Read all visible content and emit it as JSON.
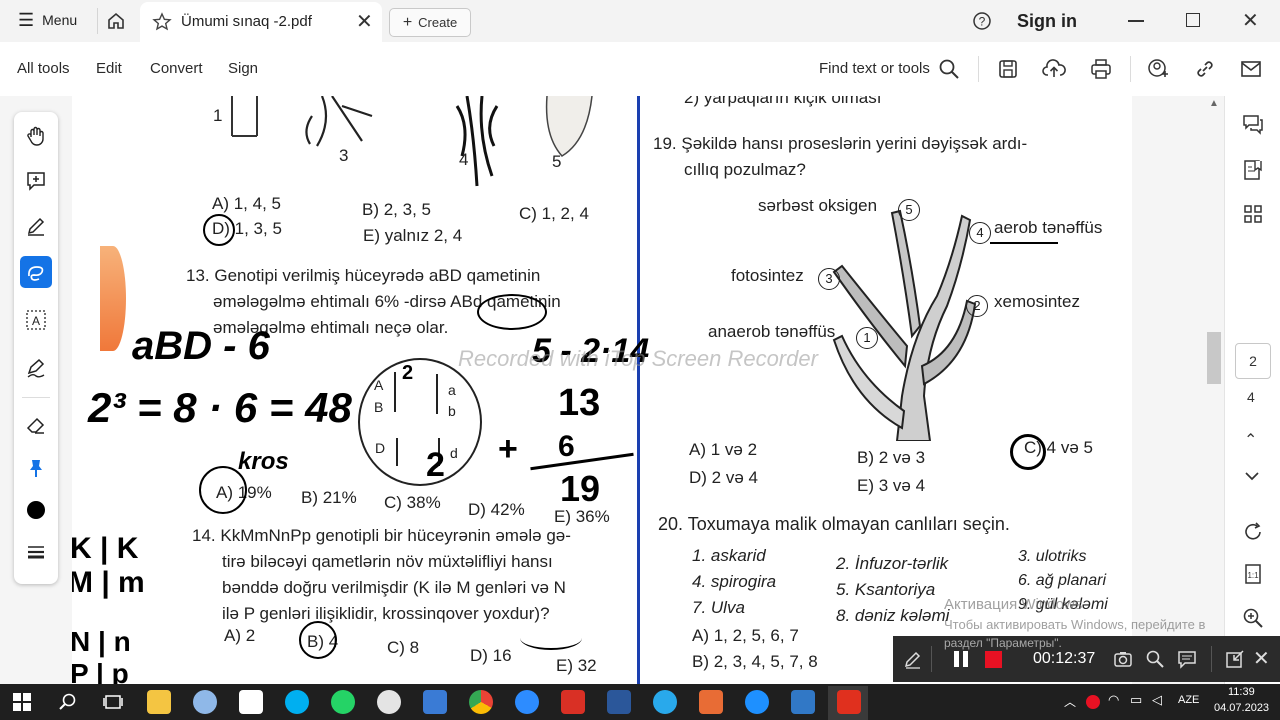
{
  "titlebar": {
    "menu_label": "Menu",
    "tab_title": "Ümumi sınaq -2.pdf",
    "create_label": "Create",
    "signin_label": "Sign in"
  },
  "toolbar": {
    "all_tools": "All tools",
    "edit": "Edit",
    "convert": "Convert",
    "sign": "Sign",
    "find_text": "Find text or tools"
  },
  "pager": {
    "current": "2",
    "total": "4"
  },
  "doc": {
    "top_label_1": "1",
    "fig_labels": [
      "3",
      "4",
      "5"
    ],
    "q12_answers": {
      "a": "A) 1, 4, 5",
      "b": "B) 2, 3, 5",
      "c": "C) 1, 2, 4",
      "d": "D) 1, 3, 5",
      "e": "E) yalnız 2, 4"
    },
    "q13_line1": "13. Genotipi verilmiş hüceyrədə aBD qametinin",
    "q13_line2": "əmələgəlmə ehtimalı 6% -dirsə ABd qametinin",
    "q13_line3": "əmələgəlmə ehtimalı neçə olar.",
    "q13_cell": [
      "A",
      "B",
      "a",
      "b",
      "D",
      "d"
    ],
    "q13_answers": {
      "a": "A) 19%",
      "b": "B) 21%",
      "c": "C) 38%",
      "d": "D) 42%",
      "e": "E) 36%"
    },
    "q14_line1": "14. KkMmNnPp genotipli bir hüceyrənin əmələ gə-",
    "q14_line2": "tirə biləcəyi qametlərin növ müxtəlifliyi hansı",
    "q14_line3": "bənddə doğru verilmişdir (K ilə M genləri və N",
    "q14_line4": "ilə P genləri ilişiklidir, krossinqover yoxdur)?",
    "q14_answers": {
      "a": "A) 2",
      "b": "B) 4",
      "c": "C) 8",
      "d": "D) 16",
      "e": "E) 32"
    },
    "top_right_cut": "2) yarpaqların kiçik olması",
    "q19_line1": "19. Şəkildə hansı proseslərin yerini dəyişsək ardı-",
    "q19_line2": "cıllıq pozulmaz?",
    "q19_labels": {
      "l5": "sərbəst oksigen",
      "l4": "aerob tənəffüs",
      "l3": "fotosintez",
      "l2": "xemosintez",
      "l1": "anaerob tənəffüs"
    },
    "q19_nums": [
      "5",
      "4",
      "3",
      "2",
      "1"
    ],
    "q19_answers": {
      "a": "A) 1 və 2",
      "b": "B) 2 və 3",
      "c": "C) 4 və 5",
      "d": "D) 2 və 4",
      "e": "E) 3 və 4"
    },
    "q20_title": "20. Toxumaya malik olmayan canlıları seçin.",
    "q20_items": [
      "1. askarid",
      "2. İnfuzor-tərlik",
      "3. ulotriks",
      "4. spirogira",
      "5. Ksantoriya",
      "6. ağ planari",
      "7. Ulva",
      "8. dəniz kələmi",
      "9. gül kələmi"
    ],
    "q20_answers": {
      "a": "A) 1, 2, 5, 6, 7",
      "b": "B) 2, 3, 4, 5, 7, 8"
    }
  },
  "handwriting": {
    "h1": "aBD - 6",
    "h2": "2³ = 8 · 6 = 48",
    "h3": "5 - 2·14",
    "h4": "13",
    "h5": "6",
    "h6": "19",
    "h7": "+",
    "h8": "2",
    "h9": "kros",
    "h10": "2",
    "h11": "K | K",
    "h12": "M | m",
    "h13": "N | n",
    "h14": "P | p"
  },
  "watermark": "Recorded with iTop Screen Recorder",
  "activation": {
    "line1": "Активация Windows",
    "line2": "Чтобы активировать Windows, перейдите в",
    "line3": "раздел \"Параметры\"."
  },
  "recorder": {
    "timer": "00:12:37"
  },
  "taskbar": {
    "lang": "AZE",
    "time": "11:39",
    "date": "04.07.2023"
  },
  "colors": {
    "accent": "#1473e6",
    "recorder_bg": "#2b2b2b",
    "taskbar_bg": "#1f1f1f",
    "record_red": "#e81123"
  }
}
